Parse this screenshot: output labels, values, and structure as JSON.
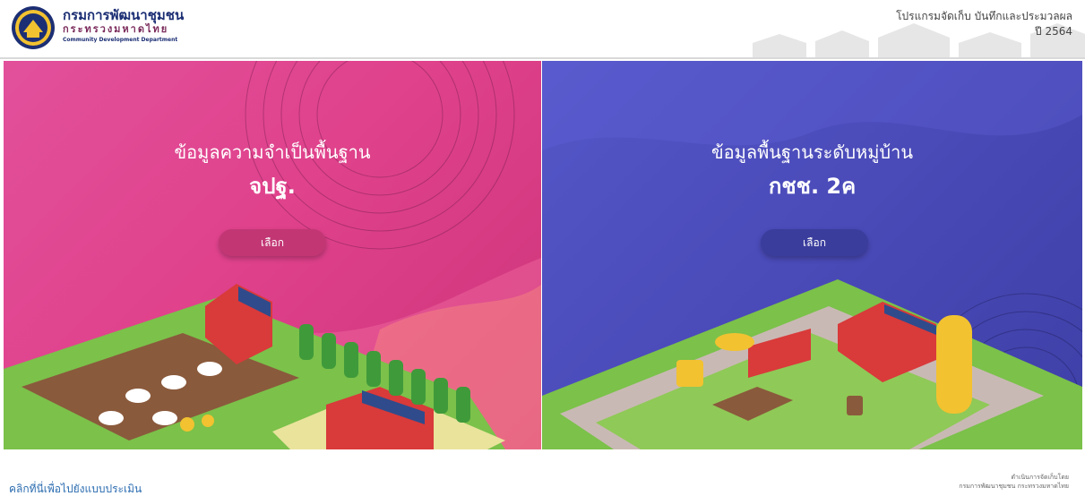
{
  "header": {
    "org_name": "กรมการพัฒนาชุมชน",
    "org_ministry": "กระทรวงมหาดไทย",
    "org_english": "Community Development Department",
    "program_title": "โปรแกรมจัดเก็บ บันทึกและประมวลผล",
    "year_label": "ปี 2564"
  },
  "panels": [
    {
      "title_line1": "ข้อมูลความจำเป็นพื้นฐาน",
      "title_line2": "จปฐ.",
      "button_label": "เลือก",
      "color": "#e0428c"
    },
    {
      "title_line1": "ข้อมูลพื้นฐานระดับหมู่บ้าน",
      "title_line2": "กชช. 2ค",
      "button_label": "เลือก",
      "color": "#4a4ab8"
    }
  ],
  "footer": {
    "survey_link": "คลิกที่นี่เพื่อไปยังแบบประเมิน",
    "credit_line1": "ดำเนินการจัดเก็บโดย",
    "credit_line2": "กรมการพัฒนาชุมชน กระทรวงมหาดไทย"
  }
}
